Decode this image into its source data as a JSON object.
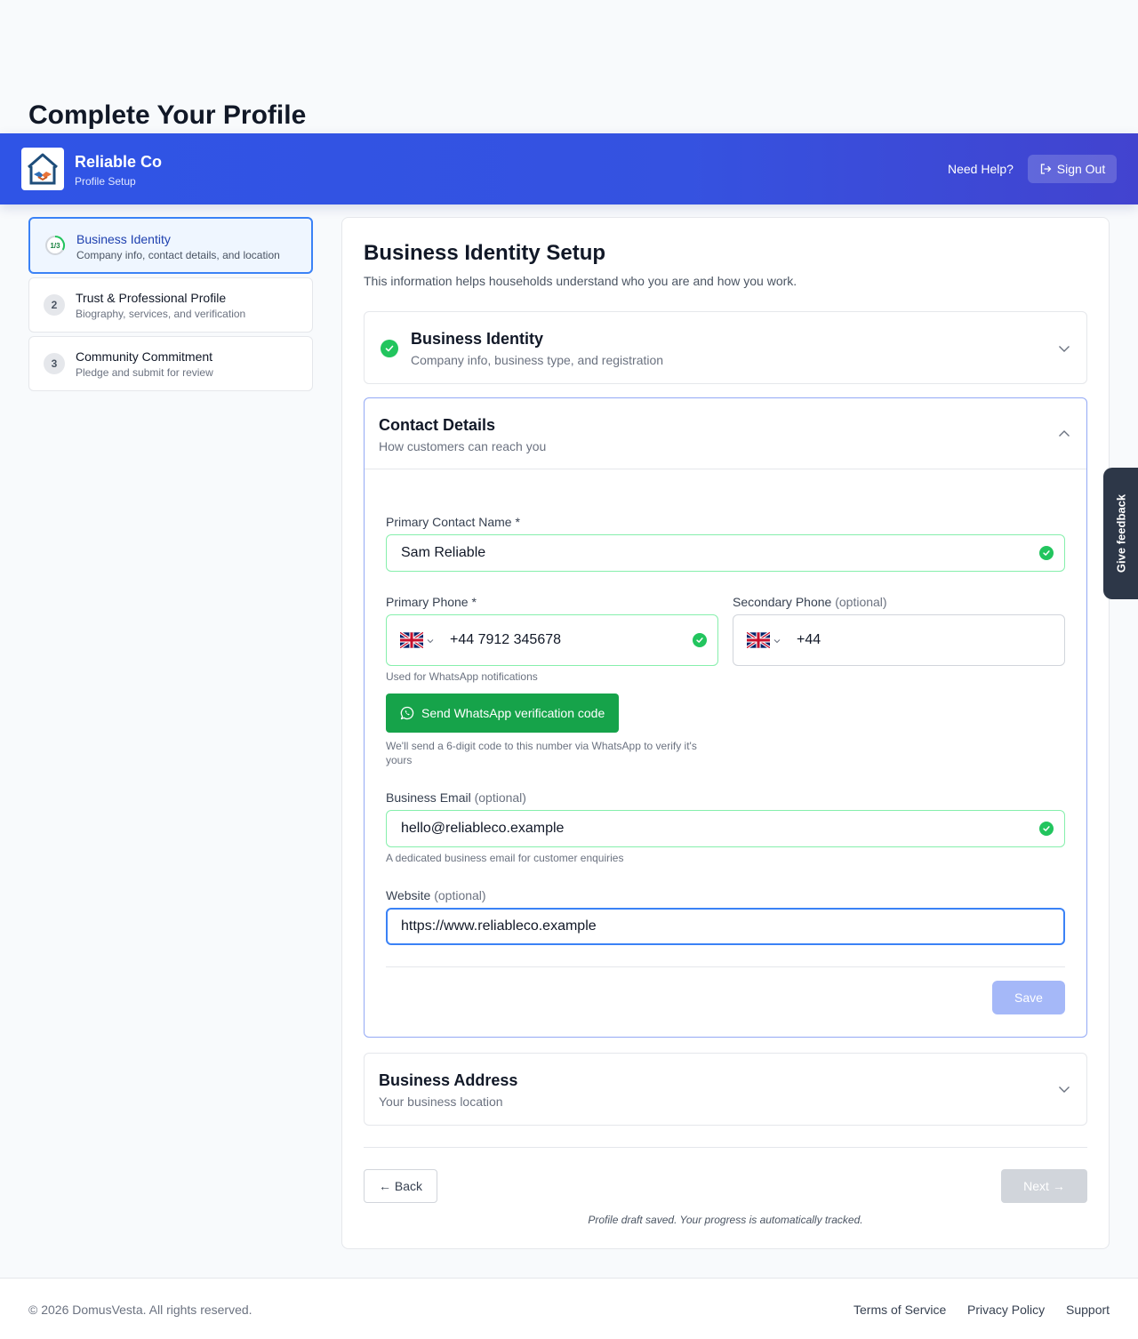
{
  "page": {
    "title": "Complete Your Profile"
  },
  "header": {
    "brand_name": "Reliable Co",
    "brand_sub": "Profile Setup",
    "need_help": "Need Help?",
    "sign_out": "Sign Out"
  },
  "steps": [
    {
      "badge": "1/3",
      "title": "Business Identity",
      "desc": "Company info, contact details, and location",
      "active": true
    },
    {
      "badge": "2",
      "title": "Trust & Professional Profile",
      "desc": "Biography, services, and verification",
      "active": false
    },
    {
      "badge": "3",
      "title": "Community Commitment",
      "desc": "Pledge and submit for review",
      "active": false
    }
  ],
  "main": {
    "title": "Business Identity Setup",
    "subtitle": "This information helps households understand who you are and how you work."
  },
  "sections": {
    "identity": {
      "title": "Business Identity",
      "sub": "Company info, business type, and registration"
    },
    "contact": {
      "title": "Contact Details",
      "sub": "How customers can reach you"
    },
    "address": {
      "title": "Business Address",
      "sub": "Your business location"
    }
  },
  "form": {
    "contact_name_label": "Primary Contact Name *",
    "contact_name": "Sam Reliable",
    "primary_phone_label": "Primary Phone *",
    "primary_phone": "+44 7912 345678",
    "primary_phone_hint": "Used for WhatsApp notifications",
    "secondary_phone_label": "Secondary Phone",
    "optional": "(optional)",
    "secondary_phone": "+44",
    "whatsapp_button": "Send WhatsApp verification code",
    "whatsapp_hint": "We'll send a 6-digit code to this number via WhatsApp to verify it's yours",
    "email_label": "Business Email",
    "email": "hello@reliableco.example",
    "email_hint": "A dedicated business email for customer enquiries",
    "website_label": "Website",
    "website": "https://www.reliableco.example",
    "save": "Save"
  },
  "nav": {
    "back": "← Back",
    "next": "Next →",
    "draft_note": "Profile draft saved. Your progress is automatically tracked."
  },
  "feedback": "Give feedback",
  "footer": {
    "copyright": "© 2026 DomusVesta. All rights reserved.",
    "terms": "Terms of Service",
    "privacy": "Privacy Policy",
    "support": "Support"
  },
  "colors": {
    "header_gradient_start": "#2f54e6",
    "header_gradient_end": "#4243cf",
    "success_green": "#22c55e",
    "whatsapp_green": "#16a34a",
    "focus_blue": "#3b82f6"
  },
  "icons": [
    "logo-house-handshake-icon",
    "sign-out-icon",
    "check-icon",
    "chevron-down-icon",
    "chevron-up-icon",
    "uk-flag-icon",
    "whatsapp-icon"
  ]
}
